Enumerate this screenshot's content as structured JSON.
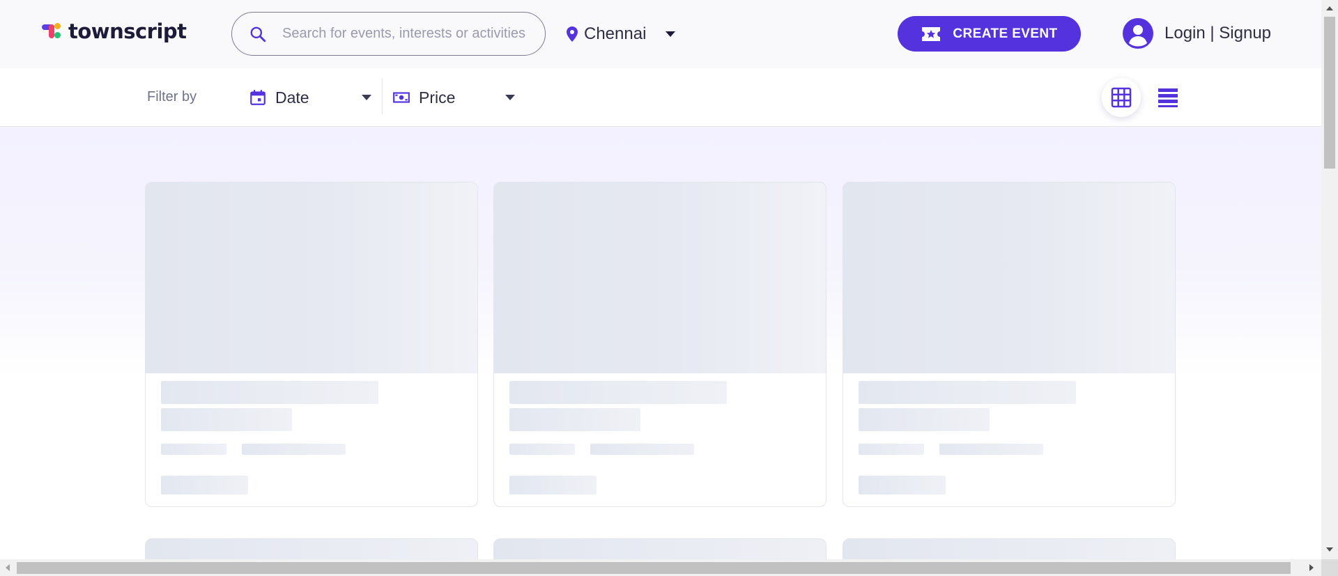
{
  "header": {
    "brand": "townscript",
    "search_placeholder": "Search for events, interests or activities",
    "location": "Chennai",
    "create_event_label": "CREATE EVENT",
    "login_label": "Login | Signup"
  },
  "filters": {
    "label": "Filter by",
    "date_label": "Date",
    "price_label": "Price"
  },
  "view_toggle": {
    "active": "grid",
    "options": [
      "grid-view-icon",
      "list-view-icon"
    ]
  },
  "event_grid": {
    "state": "loading",
    "placeholder_cards": 6
  },
  "colors": {
    "brand_primary": "#5433df",
    "text_dark": "#2d2d44",
    "text_muted": "#6e7189",
    "skeleton": "#e3e7f0"
  }
}
